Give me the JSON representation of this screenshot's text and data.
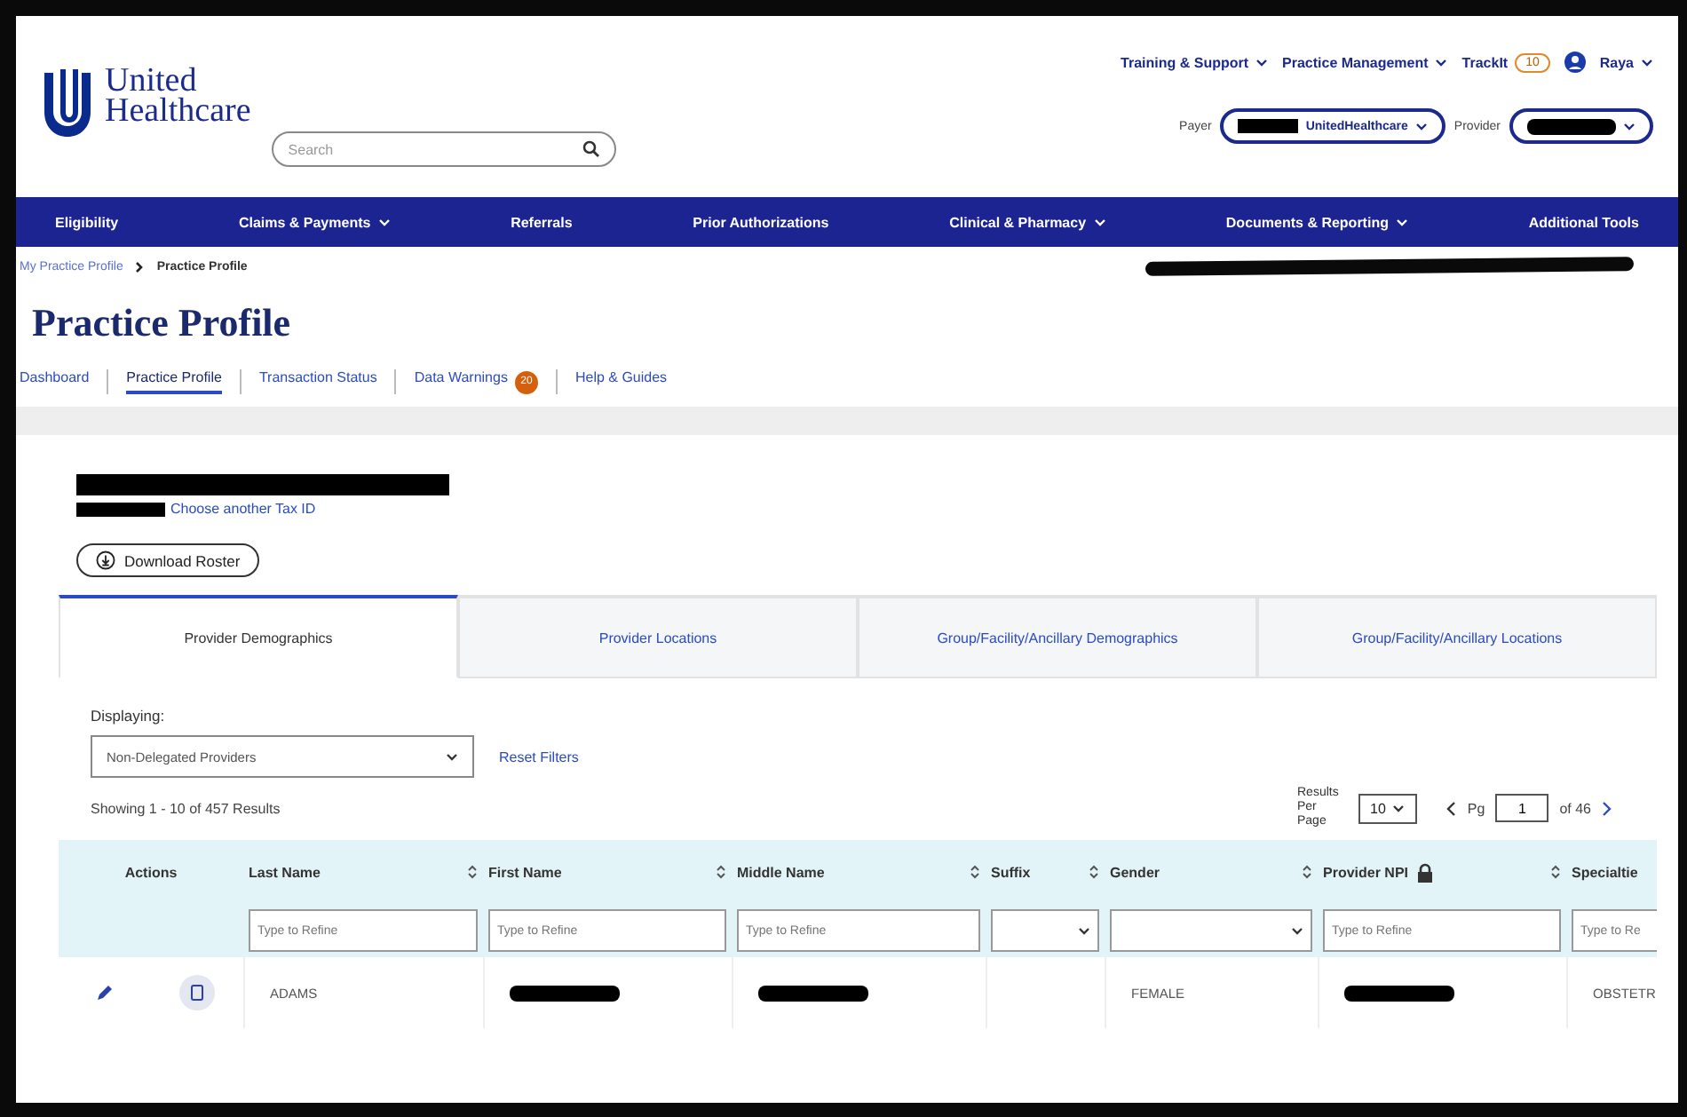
{
  "header": {
    "logo_line1": "United",
    "logo_line2": "Healthcare",
    "search": {
      "placeholder": "Search"
    },
    "top_links": [
      {
        "label": "Training & Support",
        "caret": true
      },
      {
        "label": "Practice Management",
        "caret": true
      }
    ],
    "tracking": {
      "label": "TrackIt",
      "badge": "10"
    },
    "user": {
      "name": "Raya"
    },
    "payer": {
      "label": "Payer",
      "value": "UnitedHealthcare",
      "redacted": true
    },
    "provider": {
      "label": "Provider",
      "redacted": true
    }
  },
  "nav": [
    {
      "label": "Eligibility",
      "caret": false
    },
    {
      "label": "Claims & Payments",
      "caret": true
    },
    {
      "label": "Referrals",
      "caret": false
    },
    {
      "label": "Prior Authorizations",
      "caret": false
    },
    {
      "label": "Clinical & Pharmacy",
      "caret": true
    },
    {
      "label": "Documents & Reporting",
      "caret": true
    },
    {
      "label": "Additional Tools",
      "caret": false
    }
  ],
  "breadcrumb": [
    {
      "label": "My Practice Profile",
      "link": true
    },
    {
      "label": "Practice Profile",
      "link": false
    }
  ],
  "page_title": "Practice Profile",
  "subtabs": [
    {
      "label": "Dashboard",
      "selected": false
    },
    {
      "label": "Practice Profile",
      "selected": true
    },
    {
      "label": "Transaction Status",
      "selected": false
    },
    {
      "label": "Data Warnings",
      "selected": false,
      "badge": "20"
    },
    {
      "label": "Help & Guides",
      "selected": false
    }
  ],
  "org": {
    "link": "Choose another Tax ID",
    "button": "Download Roster"
  },
  "section_tabs": [
    {
      "label": "Provider Demographics",
      "selected": true
    },
    {
      "label": "Provider Locations",
      "selected": false
    },
    {
      "label": "Group/Facility/Ancillary Demographics",
      "selected": false
    },
    {
      "label": "Group/Facility/Ancillary Locations",
      "selected": false
    }
  ],
  "filters": {
    "label": "Displaying:",
    "value": "Non-Delegated Providers",
    "reset": "Reset Filters"
  },
  "results": {
    "summary": "Showing 1 - 10 of 457 Results",
    "per_page_label": "Results Per Page",
    "per_page": "10",
    "page_label": "Pg",
    "page": "1",
    "page_total": "of 46"
  },
  "table": {
    "actions_label": "Actions",
    "columns": [
      {
        "label": "Last Name",
        "kind": "text",
        "placeholder": "Type to Refine",
        "lock": false
      },
      {
        "label": "First Name",
        "kind": "text",
        "placeholder": "Type to Refine",
        "lock": false
      },
      {
        "label": "Middle Name",
        "kind": "text",
        "placeholder": "Type to Refine",
        "lock": false
      },
      {
        "label": "Suffix",
        "kind": "select",
        "lock": false
      },
      {
        "label": "Gender",
        "kind": "select",
        "lock": false
      },
      {
        "label": "Provider NPI",
        "kind": "text",
        "placeholder": "Type to Refine",
        "lock": true
      },
      {
        "label": "Specialtie",
        "kind": "text",
        "placeholder": "Type to Re",
        "lock": false
      }
    ],
    "rows": [
      {
        "cells": [
          {
            "text": "ADAMS",
            "redacted": false
          },
          {
            "redacted": true
          },
          {
            "redacted": true
          },
          {
            "redacted": false
          },
          {
            "text": "FEMALE",
            "redacted": false
          },
          {
            "redacted": true
          },
          {
            "text": "OBSTETR",
            "redacted": false
          }
        ]
      }
    ]
  }
}
